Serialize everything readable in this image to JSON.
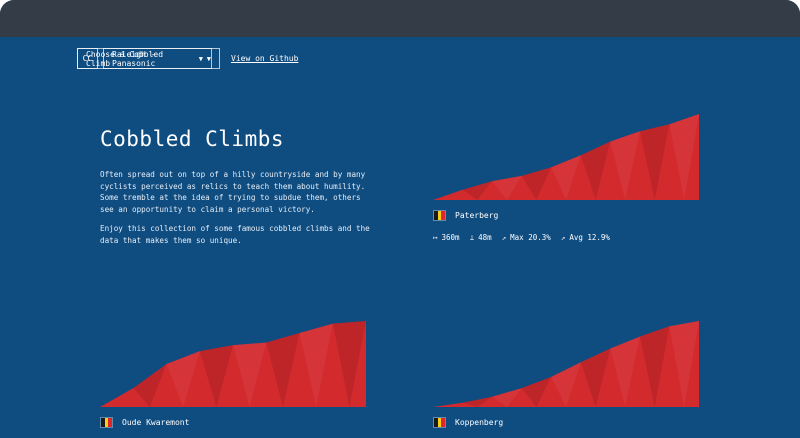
{
  "nav": {
    "logo": "CC",
    "climb_select": "Choose a Cobbled Climb",
    "team_select": "Raleigh - Panasonic",
    "github_link": "View on Github"
  },
  "intro": {
    "title": "Cobbled Climbs",
    "paragraph1": "Often spread out on top of a hilly countryside and by many cyclists perceived as relics to teach them about humility. Some tremble at the idea of trying to subdue them, others see an opportunity to claim a personal victory.",
    "paragraph2": "Enjoy this collection of some famous cobbled climbs and the data that makes them so unique."
  },
  "colors": {
    "background": "#0f4c80",
    "titlebar": "#343d47",
    "profile_fill": "#d32a2e"
  },
  "climbs": [
    {
      "name": "Paterberg",
      "country": "belgium-flag-icon",
      "stats": {
        "length": "360m",
        "elevation": "48m",
        "max": "Max 20.3%",
        "avg": "Avg 12.9%"
      },
      "profile": [
        0,
        0.12,
        0.22,
        0.28,
        0.38,
        0.52,
        0.68,
        0.8,
        0.88,
        1.0
      ]
    },
    {
      "name": "Oude Kwaremont",
      "country": "belgium-flag-icon",
      "profile": [
        0,
        0.22,
        0.5,
        0.65,
        0.72,
        0.75,
        0.86,
        0.97,
        1.0
      ]
    },
    {
      "name": "Koppenberg",
      "country": "belgium-flag-icon",
      "profile": [
        0,
        0.05,
        0.12,
        0.22,
        0.35,
        0.52,
        0.68,
        0.82,
        0.94,
        1.0
      ]
    }
  ]
}
